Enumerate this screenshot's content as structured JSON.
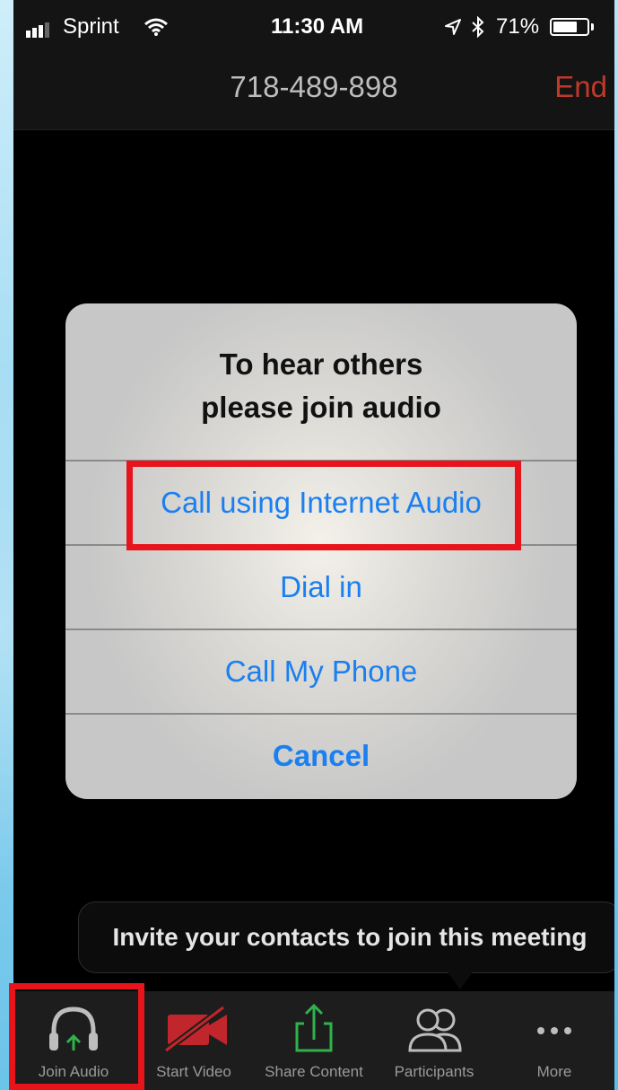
{
  "status_bar": {
    "carrier": "Sprint",
    "time": "11:30 AM",
    "battery": "71%",
    "battery_level": 0.71,
    "icons": [
      "signal-icon",
      "wifi-icon",
      "location-icon",
      "bluetooth-icon",
      "battery-icon"
    ]
  },
  "header": {
    "meeting_id": "718-489-898",
    "end_label": "End",
    "end_color": "#c0392b"
  },
  "dialog": {
    "title_line1": "To hear others",
    "title_line2": "please join audio",
    "options": {
      "internet_audio": "Call using Internet Audio",
      "dial_in": "Dial in",
      "call_my_phone": "Call My Phone",
      "cancel": "Cancel"
    },
    "link_color": "#1a7ff0"
  },
  "invite": {
    "text": "Invite your contacts to join this meeting"
  },
  "toolbar": {
    "join_audio": "Join Audio",
    "start_video": "Start Video",
    "share_content": "Share Content",
    "participants": "Participants",
    "more": "More"
  },
  "highlight_color": "#e8141b"
}
